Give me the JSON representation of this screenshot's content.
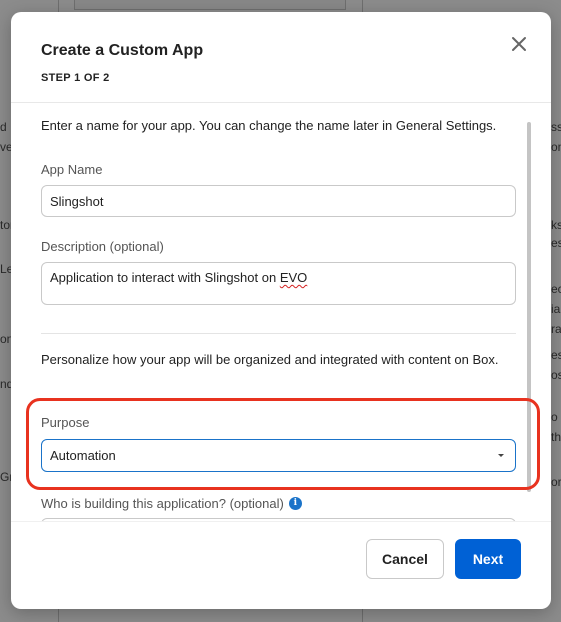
{
  "background_fragments": [
    "d",
    "ve",
    "ton",
    "Le",
    "on",
    "nd",
    "ss",
    "on",
    "ks",
    "es",
    "ec",
    "ia",
    "ra",
    "es",
    "os",
    "o",
    "th",
    "or",
    "Gr"
  ],
  "modal": {
    "title": "Create a Custom App",
    "step": "STEP 1 OF 2",
    "close_icon": "close-icon",
    "intro": "Enter a name for your app. You can change the name later in General Settings.",
    "app_name": {
      "label": "App Name",
      "value": "Slingshot"
    },
    "description": {
      "label": "Description (optional)",
      "value_prefix": "Application to interact with Slingshot on ",
      "value_flagged": "EVO"
    },
    "personalize_text": "Personalize how your app will be organized and integrated with content on Box.",
    "purpose": {
      "label": "Purpose",
      "selected": "Automation"
    },
    "who_building": {
      "label": "Who is building this application? (optional)",
      "info_icon": "info-icon"
    },
    "buttons": {
      "cancel": "Cancel",
      "next": "Next"
    }
  },
  "colors": {
    "primary": "#0061d5",
    "focus_border": "#1a73c9",
    "highlight": "#e8321f",
    "spellcheck": "#d42020"
  }
}
